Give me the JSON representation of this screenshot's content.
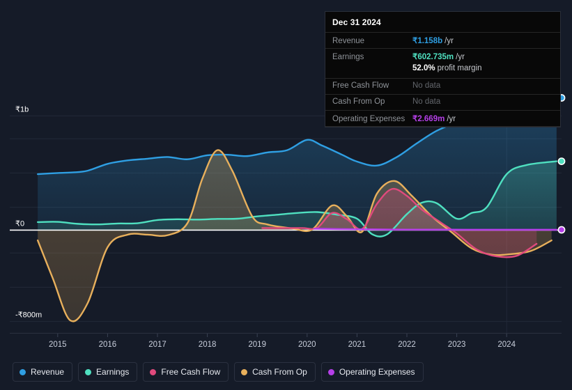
{
  "colors": {
    "background": "#151b28",
    "revenue": "#2f9fe3",
    "earnings": "#4fe0c0",
    "free_cash_flow": "#e04a7d",
    "cash_from_op": "#e8b05c",
    "operating_expenses": "#b53fe8",
    "zero_line": "#ffffff",
    "gridline": "#232a38",
    "tooltip_bg": "#080808"
  },
  "tooltip": {
    "title": "Dec 31 2024",
    "rows": [
      {
        "label": "Revenue",
        "value": "₹1.158b",
        "unit": "/yr",
        "color": "#2f9fe3",
        "no_data": false
      },
      {
        "label": "Earnings",
        "value": "₹602.735m",
        "unit": "/yr",
        "color": "#4fe0c0",
        "no_data": false
      },
      {
        "label": "",
        "value": "52.0%",
        "unit": "profit margin",
        "color": "#ffffff",
        "no_data": false,
        "sub": true
      },
      {
        "label": "Free Cash Flow",
        "value": "No data",
        "unit": "",
        "color": "#63666c",
        "no_data": true
      },
      {
        "label": "Cash From Op",
        "value": "No data",
        "unit": "",
        "color": "#63666c",
        "no_data": true
      },
      {
        "label": "Operating Expenses",
        "value": "₹2.669m",
        "unit": "/yr",
        "color": "#b53fe8",
        "no_data": false
      }
    ]
  },
  "legend": {
    "items": [
      {
        "label": "Revenue",
        "color": "#2f9fe3"
      },
      {
        "label": "Earnings",
        "color": "#4fe0c0"
      },
      {
        "label": "Free Cash Flow",
        "color": "#e04a7d"
      },
      {
        "label": "Cash From Op",
        "color": "#e8b05c"
      },
      {
        "label": "Operating Expenses",
        "color": "#b53fe8"
      }
    ]
  },
  "chart_data": {
    "type": "area",
    "title": "",
    "xlabel": "",
    "ylabel": "",
    "grid": true,
    "legend_position": "bottom",
    "currency": "₹",
    "xlim": [
      2014.5,
      2025.1
    ],
    "ylim": [
      -900000000,
      1100000000
    ],
    "ytick_values": [
      1000000000,
      0,
      -800000000
    ],
    "ytick_labels": [
      "₹1b",
      "₹0",
      "-₹800m"
    ],
    "xtick_labels": [
      "2015",
      "2016",
      "2017",
      "2018",
      "2019",
      "2020",
      "2021",
      "2022",
      "2023",
      "2024"
    ],
    "xtick_values": [
      2015,
      2016,
      2017,
      2018,
      2019,
      2020,
      2021,
      2022,
      2023,
      2024
    ],
    "series": [
      {
        "name": "Revenue",
        "color": "#2f9fe3",
        "x": [
          2014.6,
          2015.0,
          2015.3,
          2015.6,
          2016.0,
          2016.4,
          2016.8,
          2017.2,
          2017.6,
          2018.0,
          2018.4,
          2018.8,
          2019.2,
          2019.6,
          2020.0,
          2020.3,
          2020.7,
          2021.0,
          2021.4,
          2021.8,
          2022.2,
          2022.6,
          2023.0,
          2023.4,
          2023.8,
          2024.2,
          2024.6,
          2025.0
        ],
        "values": [
          490000000,
          500000000,
          505000000,
          520000000,
          580000000,
          610000000,
          625000000,
          640000000,
          620000000,
          655000000,
          660000000,
          648000000,
          680000000,
          700000000,
          790000000,
          740000000,
          660000000,
          600000000,
          565000000,
          640000000,
          760000000,
          870000000,
          940000000,
          985000000,
          1035000000,
          1080000000,
          1125000000,
          1158000000
        ]
      },
      {
        "name": "Earnings",
        "color": "#4fe0c0",
        "x": [
          2014.6,
          2015.0,
          2015.4,
          2015.8,
          2016.2,
          2016.6,
          2017.0,
          2017.4,
          2017.8,
          2018.2,
          2018.6,
          2019.0,
          2019.4,
          2019.8,
          2020.2,
          2020.6,
          2021.0,
          2021.3,
          2021.6,
          2022.0,
          2022.3,
          2022.6,
          2023.0,
          2023.3,
          2023.6,
          2024.0,
          2024.4,
          2025.0
        ],
        "values": [
          70000000,
          72000000,
          55000000,
          50000000,
          58000000,
          60000000,
          88000000,
          95000000,
          92000000,
          98000000,
          100000000,
          120000000,
          135000000,
          150000000,
          158000000,
          135000000,
          100000000,
          -35000000,
          -38000000,
          140000000,
          240000000,
          235000000,
          100000000,
          150000000,
          200000000,
          490000000,
          570000000,
          602735000
        ]
      },
      {
        "name": "Free Cash Flow",
        "color": "#e04a7d",
        "x": [
          2019.1,
          2019.5,
          2019.9,
          2020.2,
          2020.5,
          2020.8,
          2021.1,
          2021.4,
          2021.7,
          2022.0,
          2022.3,
          2022.7,
          2023.0,
          2023.4,
          2023.8,
          2024.2,
          2024.6
        ],
        "values": [
          18000000,
          18000000,
          18000000,
          20000000,
          150000000,
          95000000,
          10000000,
          230000000,
          360000000,
          300000000,
          180000000,
          60000000,
          -30000000,
          -170000000,
          -230000000,
          -225000000,
          -120000000
        ]
      },
      {
        "name": "Cash From Op",
        "color": "#e8b05c",
        "x": [
          2014.6,
          2014.9,
          2015.25,
          2015.6,
          2016.0,
          2016.4,
          2016.8,
          2017.2,
          2017.6,
          2017.9,
          2018.2,
          2018.5,
          2018.9,
          2019.2,
          2019.7,
          2020.1,
          2020.5,
          2020.8,
          2021.1,
          2021.4,
          2021.75,
          2022.1,
          2022.5,
          2022.9,
          2023.3,
          2023.7,
          2024.1,
          2024.5,
          2024.9
        ],
        "values": [
          -90000000,
          -420000000,
          -790000000,
          -640000000,
          -150000000,
          -40000000,
          -40000000,
          -45000000,
          60000000,
          450000000,
          700000000,
          520000000,
          120000000,
          50000000,
          15000000,
          5000000,
          215000000,
          120000000,
          -15000000,
          320000000,
          430000000,
          300000000,
          120000000,
          -20000000,
          -160000000,
          -215000000,
          -210000000,
          -180000000,
          -90000000
        ]
      },
      {
        "name": "Operating Expenses",
        "color": "#b53fe8",
        "x": [
          2020.15,
          2020.6,
          2021.0,
          2021.5,
          2022.0,
          2022.6,
          2023.2,
          2023.8,
          2024.4,
          2025.0
        ],
        "values": [
          12000000,
          9000000,
          7000000,
          5000000,
          4000000,
          3500000,
          3200000,
          3000000,
          2800000,
          2669000
        ]
      }
    ],
    "end_markers": [
      {
        "name": "Revenue",
        "color": "#2f9fe3",
        "value": 1158000000
      },
      {
        "name": "Earnings",
        "color": "#4fe0c0",
        "value": 602735000
      },
      {
        "name": "Operating Expenses",
        "color": "#b53fe8",
        "value": 2669000
      }
    ]
  }
}
